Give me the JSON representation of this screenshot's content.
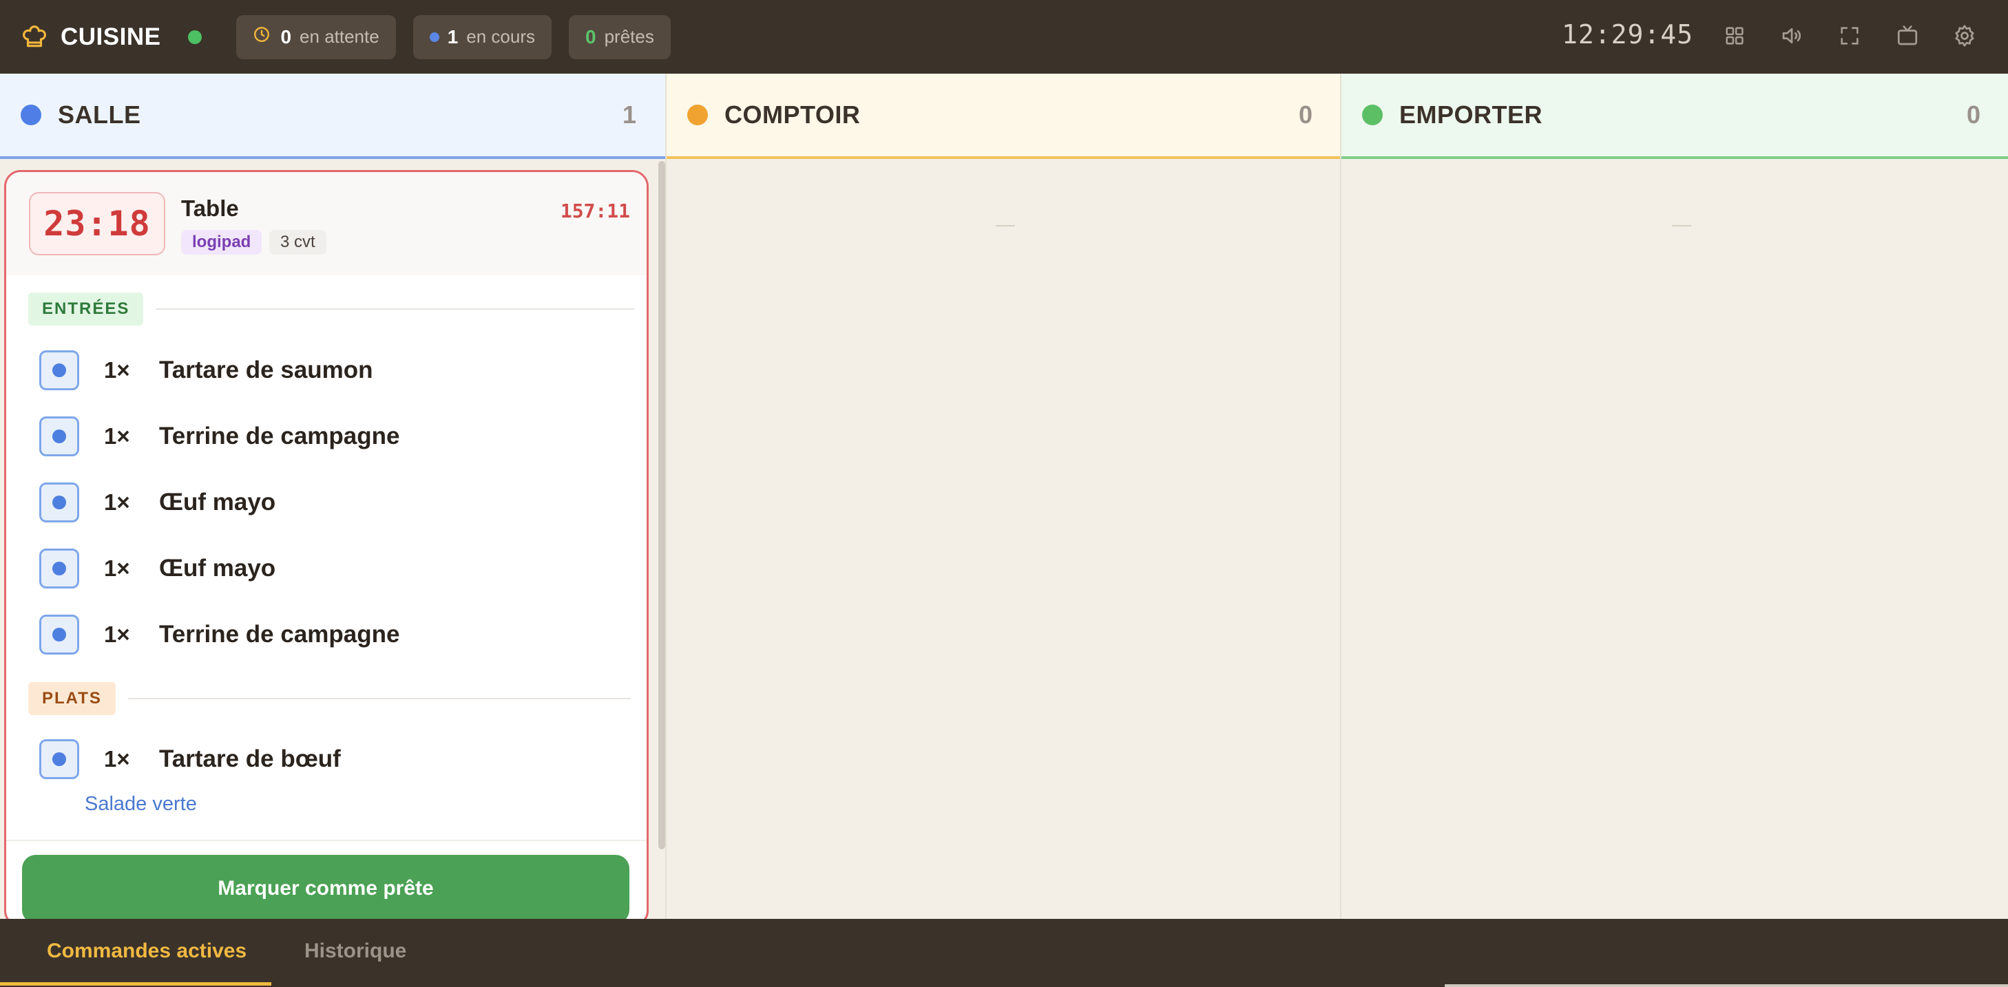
{
  "header": {
    "app_title": "CUISINE",
    "status": {
      "waiting_count": "0",
      "waiting_label": "en attente",
      "in_progress_count": "1",
      "in_progress_label": "en cours",
      "ready_count": "0",
      "ready_label": "prêtes"
    },
    "clock": "12:29:45",
    "icons": [
      "chef-hat-icon",
      "grid-icon",
      "volume-icon",
      "fullscreen-icon",
      "tv-icon",
      "settings-icon"
    ]
  },
  "columns": [
    {
      "title": "SALLE",
      "count": "1",
      "color": "#4f7fe6"
    },
    {
      "title": "COMPTOIR",
      "count": "0",
      "color": "#f0a330"
    },
    {
      "title": "EMPORTER",
      "count": "0",
      "color": "#5cbf66"
    }
  ],
  "order": {
    "timer": "23:18",
    "title": "Table",
    "source_tag": "logipad",
    "covers_tag": "3 cvt",
    "elapsed": "157:11",
    "sections": [
      {
        "label": "ENTRÉES",
        "items": [
          {
            "qty": "1×",
            "name": "Tartare de saumon"
          },
          {
            "qty": "1×",
            "name": "Terrine de campagne"
          },
          {
            "qty": "1×",
            "name": "Œuf mayo"
          },
          {
            "qty": "1×",
            "name": "Œuf mayo"
          },
          {
            "qty": "1×",
            "name": "Terrine de campagne"
          }
        ]
      },
      {
        "label": "PLATS",
        "items": [
          {
            "qty": "1×",
            "name": "Tartare de bœuf",
            "modifier": "Salade verte"
          }
        ]
      }
    ],
    "action_label": "Marquer comme prête"
  },
  "empty_placeholder": "—",
  "bottom_nav": {
    "tabs": [
      {
        "label": "Commandes actives",
        "active": true
      },
      {
        "label": "Historique",
        "active": false
      }
    ]
  }
}
